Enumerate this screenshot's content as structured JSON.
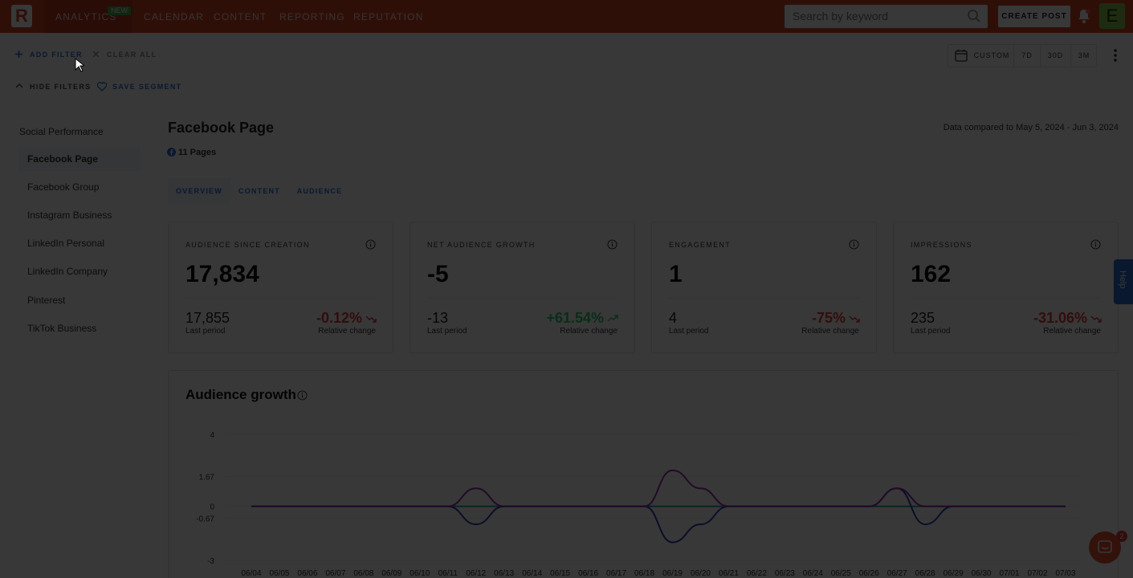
{
  "topnav": {
    "logo_letter": "R",
    "items": [
      {
        "label": "ANALYTICS",
        "badge": "NEW"
      },
      {
        "label": "CALENDAR"
      },
      {
        "label": "CONTENT"
      },
      {
        "label": "REPORTING"
      },
      {
        "label": "REPUTATION"
      }
    ],
    "search_placeholder": "Search by keyword",
    "create_post_label": "CREATE POST",
    "avatar_letter": "E",
    "brand_color": "#d24726"
  },
  "filters": {
    "add_filter": "ADD FILTER",
    "clear_all": "CLEAR ALL",
    "hide_filters": "HIDE FILTERS",
    "save_segment": "SAVE SEGMENT",
    "date_options": [
      "CUSTOM",
      "7D",
      "30D",
      "3M"
    ]
  },
  "sidebar": {
    "heading": "Social Performance",
    "items": [
      {
        "label": "Facebook Page",
        "active": true
      },
      {
        "label": "Facebook Group"
      },
      {
        "label": "Instagram Business"
      },
      {
        "label": "LinkedIn Personal"
      },
      {
        "label": "LinkedIn Company"
      },
      {
        "label": "Pinterest"
      },
      {
        "label": "TikTok Business"
      }
    ]
  },
  "main": {
    "title": "Facebook Page",
    "pages_count": "11 Pages",
    "compare_text": "Data compared to May 5, 2024 - Jun 3, 2024",
    "tabs": [
      {
        "label": "OVERVIEW",
        "active": true
      },
      {
        "label": "CONTENT"
      },
      {
        "label": "AUDIENCE"
      }
    ]
  },
  "cards": [
    {
      "label": "AUDIENCE SINCE CREATION",
      "value": "17,834",
      "prev": "17,855",
      "prev_label": "Last period",
      "change": "-0.12%",
      "change_label": "Relative change",
      "trend": "down"
    },
    {
      "label": "NET AUDIENCE GROWTH",
      "value": "-5",
      "prev": "-13",
      "prev_label": "Last period",
      "change": "+61.54%",
      "change_label": "Relative change",
      "trend": "up"
    },
    {
      "label": "ENGAGEMENT",
      "value": "1",
      "prev": "4",
      "prev_label": "Last period",
      "change": "-75%",
      "change_label": "Relative change",
      "trend": "down"
    },
    {
      "label": "IMPRESSIONS",
      "value": "162",
      "prev": "235",
      "prev_label": "Last period",
      "change": "-31.06%",
      "change_label": "Relative change",
      "trend": "down"
    }
  ],
  "chart_title": "Audience growth",
  "help_label": "Help",
  "intercom_badge": "2",
  "chart_data": {
    "type": "line",
    "title": "Audience growth",
    "ylim": [
      -3,
      4
    ],
    "yticks": [
      "4",
      "1.67",
      "0",
      "-0.67",
      "-3"
    ],
    "ytick_values": [
      4,
      1.67,
      0,
      -0.67,
      -3
    ],
    "categories": [
      "06/04",
      "06/05",
      "06/06",
      "06/07",
      "06/08",
      "06/09",
      "06/10",
      "06/11",
      "06/12",
      "06/13",
      "06/14",
      "06/15",
      "06/16",
      "06/17",
      "06/18",
      "06/19",
      "06/20",
      "06/21",
      "06/22",
      "06/23",
      "06/24",
      "06/25",
      "06/26",
      "06/27",
      "06/28",
      "06/29",
      "06/30",
      "07/01",
      "07/02",
      "07/03"
    ],
    "series": [
      {
        "color": "#9b2fb5",
        "values": [
          0,
          0,
          0,
          0,
          0,
          0,
          0,
          0,
          1,
          0,
          0,
          0,
          0,
          0,
          0,
          2,
          1,
          0,
          0,
          0,
          0,
          0,
          0,
          1,
          0,
          0,
          0,
          0,
          0,
          0
        ]
      },
      {
        "color": "#2e3fb5",
        "values": [
          0,
          0,
          0,
          0,
          0,
          0,
          0,
          0,
          -1,
          0,
          0,
          0,
          0,
          0,
          0,
          -2,
          -1,
          0,
          0,
          0,
          0,
          0,
          0,
          1,
          -1,
          0,
          0,
          0,
          0,
          0
        ]
      },
      {
        "color": "#27a9a0",
        "values": [
          0,
          0,
          0,
          0,
          0,
          0,
          0,
          0,
          0,
          0,
          0,
          0,
          0,
          0,
          0,
          0,
          0,
          0,
          0,
          0,
          0,
          0,
          0,
          0,
          0,
          0,
          0,
          0,
          0,
          0
        ]
      }
    ],
    "grid": true
  }
}
